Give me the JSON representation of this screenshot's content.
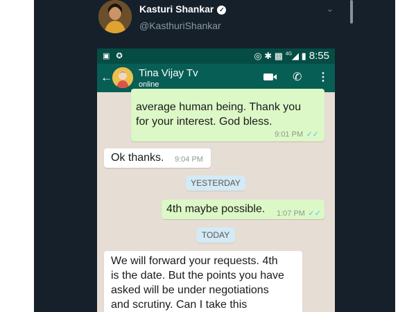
{
  "tweet": {
    "author_name": "Kasturi Shankar",
    "handle": "@KasthuriShankar"
  },
  "status_bar": {
    "network": "4G",
    "time": "8:55"
  },
  "chat": {
    "contact_name": "Tina Vijay Tv",
    "contact_status": "online",
    "messages": [
      {
        "direction": "out",
        "text_lines": [
          "average human being.   Thank you",
          "for your interest. God bless."
        ],
        "time": "9:01 PM"
      },
      {
        "direction": "in",
        "text": "Ok thanks.",
        "time": "9:04 PM"
      },
      {
        "direction": "date",
        "text": "YESTERDAY"
      },
      {
        "direction": "out",
        "text": "4th maybe possible.",
        "time": "1:07 PM"
      },
      {
        "direction": "date",
        "text": "TODAY"
      },
      {
        "direction": "in",
        "text_lines": [
          "We will forward your requests. 4th",
          "is the date. But the points you have",
          "asked will be under negotiations",
          "and scrutiny. Can I take this"
        ]
      }
    ]
  },
  "colors": {
    "twitter_bg": "#15202b",
    "whatsapp_header": "#075e54",
    "whatsapp_statusbar": "#054d44",
    "bubble_out": "#dcf8c6",
    "bubble_in": "#ffffff",
    "chat_bg": "#e6ddd4",
    "read_ticks": "#4fc3f7"
  }
}
